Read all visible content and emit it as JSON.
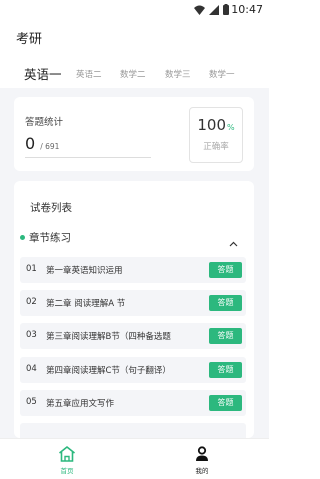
{
  "status_bar": {
    "time": "10:47"
  },
  "app": {
    "title": "考研"
  },
  "subject_tabs": [
    {
      "label": "英语一",
      "active": true
    },
    {
      "label": "英语二",
      "active": false
    },
    {
      "label": "数学二",
      "active": false
    },
    {
      "label": "数学三",
      "active": false
    },
    {
      "label": "数学一",
      "active": false
    }
  ],
  "stats": {
    "label": "答题统计",
    "answered": "0",
    "total": "/ 691",
    "rate_value": "100",
    "rate_unit": "%",
    "rate_label": "正确率"
  },
  "paper_list": {
    "title": "试卷列表",
    "section": "章节练习",
    "chapters": [
      {
        "num": "01",
        "title": "第一章英语知识运用",
        "button": "答题"
      },
      {
        "num": "02",
        "title": "第二章 阅读理解A 节",
        "button": "答题"
      },
      {
        "num": "03",
        "title": "第三章阅读理解B节（四种备选题",
        "button": "答题"
      },
      {
        "num": "04",
        "title": "第四章阅读理解C节（句子翻译）",
        "button": "答题"
      },
      {
        "num": "05",
        "title": "第五章应用文写作",
        "button": "答题"
      }
    ]
  },
  "bottom_nav": {
    "home": "首页",
    "mine": "我的"
  },
  "colors": {
    "accent": "#2cb87e",
    "background": "#f4f5f8"
  }
}
